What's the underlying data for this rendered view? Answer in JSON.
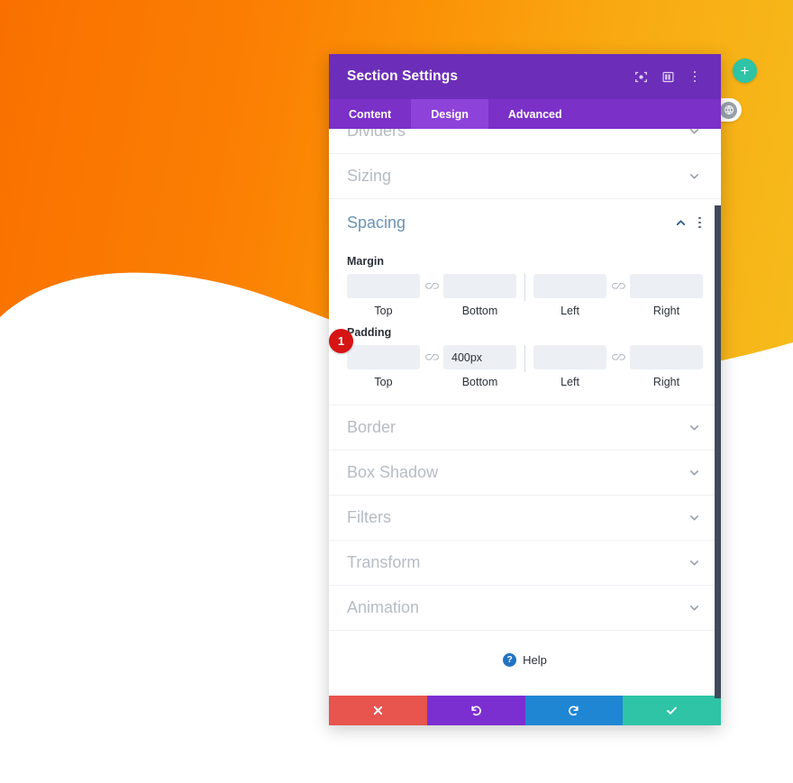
{
  "background": {
    "gradient_from": "#f97000",
    "gradient_to": "#f6bb1b",
    "wave_color": "#ffffff"
  },
  "floating": {
    "add_button_label": "+",
    "add_button_color": "#2ec4a5",
    "settings_icon": "globe-gear-icon"
  },
  "modal": {
    "title": "Section Settings",
    "header_color": "#6c2eb9",
    "header_icons": [
      {
        "name": "focus-target-icon"
      },
      {
        "name": "layout-columns-icon"
      },
      {
        "name": "more-vertical-icon"
      }
    ],
    "tabs": [
      {
        "label": "Content",
        "active": false
      },
      {
        "label": "Design",
        "active": true
      },
      {
        "label": "Advanced",
        "active": false
      }
    ],
    "sections_above": [
      {
        "label": "Dividers",
        "state": "collapsed"
      },
      {
        "label": "Sizing",
        "state": "collapsed"
      }
    ],
    "spacing": {
      "title": "Spacing",
      "state": "expanded",
      "title_color": "#6a93b5",
      "groups": [
        {
          "label": "Margin",
          "badge": null,
          "fields": [
            {
              "caption": "Top",
              "value": "",
              "placeholder": ""
            },
            {
              "caption": "Bottom",
              "value": "",
              "placeholder": ""
            },
            {
              "caption": "Left",
              "value": "",
              "placeholder": ""
            },
            {
              "caption": "Right",
              "value": "",
              "placeholder": ""
            }
          ]
        },
        {
          "label": "Padding",
          "badge": "1",
          "badge_color": "#d61414",
          "fields": [
            {
              "caption": "Top",
              "value": "",
              "placeholder": ""
            },
            {
              "caption": "Bottom",
              "value": "400px",
              "placeholder": ""
            },
            {
              "caption": "Left",
              "value": "",
              "placeholder": ""
            },
            {
              "caption": "Right",
              "value": "",
              "placeholder": ""
            }
          ]
        }
      ]
    },
    "sections_below": [
      {
        "label": "Border",
        "state": "collapsed"
      },
      {
        "label": "Box Shadow",
        "state": "collapsed"
      },
      {
        "label": "Filters",
        "state": "collapsed"
      },
      {
        "label": "Transform",
        "state": "collapsed"
      },
      {
        "label": "Animation",
        "state": "collapsed"
      }
    ],
    "help": {
      "label": "Help",
      "icon": "question-circle-icon"
    },
    "footer_buttons": [
      {
        "name": "cancel",
        "icon": "close-x-icon",
        "color": "#e8544e"
      },
      {
        "name": "undo",
        "icon": "undo-arrow-icon",
        "color": "#7b2fd0"
      },
      {
        "name": "redo",
        "icon": "redo-arrow-icon",
        "color": "#1f86d4"
      },
      {
        "name": "save",
        "icon": "check-icon",
        "color": "#2ec4a5"
      }
    ]
  }
}
